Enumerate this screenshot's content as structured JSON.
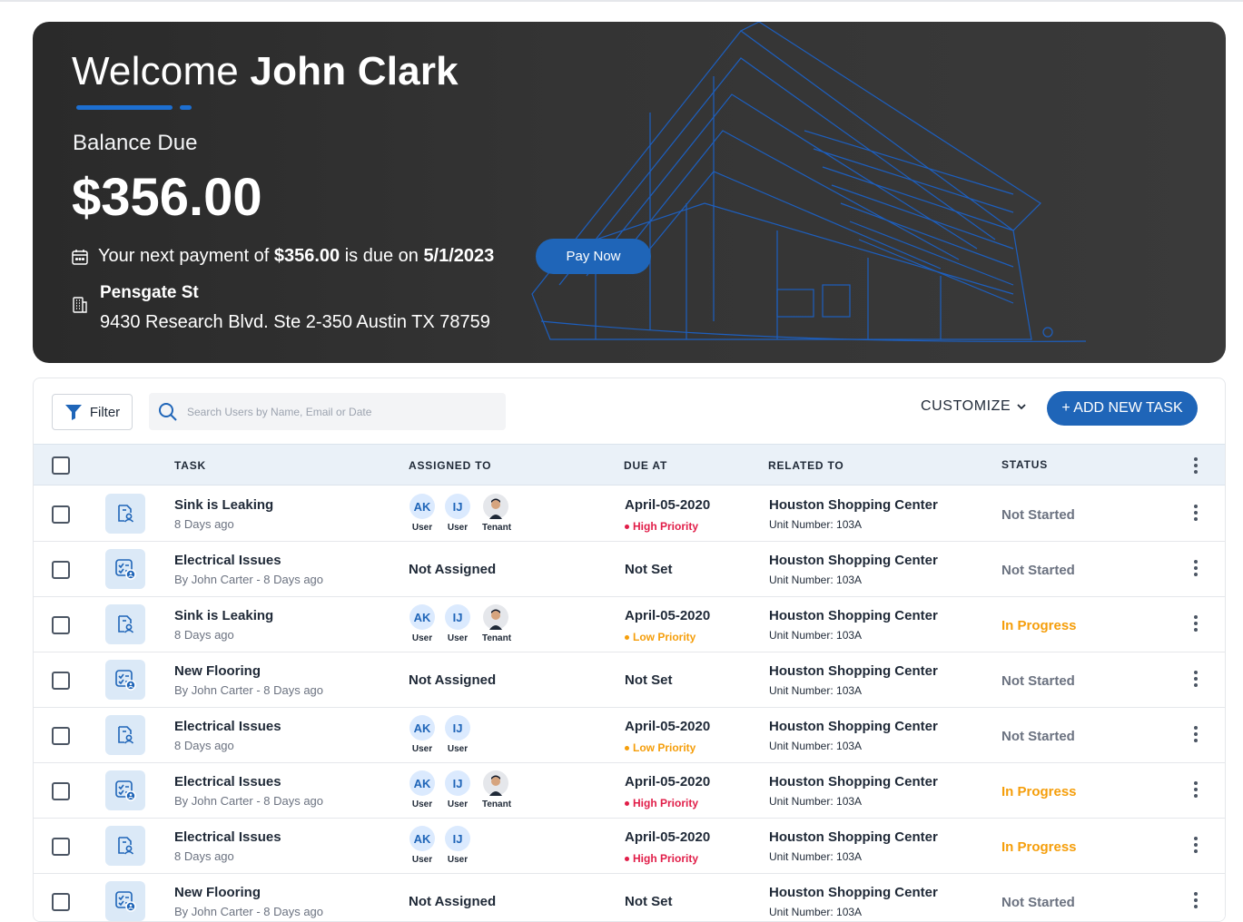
{
  "hero": {
    "welcome_prefix": "Welcome",
    "user_name": "John Clark",
    "balance_label": "Balance Due",
    "balance_amount": "$356.00",
    "next_payment_prefix": "Your next payment of",
    "next_payment_amount": "$356.00",
    "next_payment_middle": "is due on",
    "next_payment_date": "5/1/2023",
    "pay_button": "Pay Now",
    "property_name": "Pensgate St",
    "property_address": "9430 Research Blvd. Ste 2-350 Austin TX 78759"
  },
  "toolbar": {
    "filter_label": "Filter",
    "search_placeholder": "Search Users by Name, Email or Date",
    "customize_label": "CUSTOMIZE",
    "add_task_label": "+ ADD NEW TASK"
  },
  "table": {
    "headers": {
      "task": "TASK",
      "assigned_to": "ASSIGNED TO",
      "due_at": "DUE AT",
      "related_to": "RELATED TO",
      "status": "STATUS"
    },
    "rows": [
      {
        "task": "Sink is Leaking",
        "subtitle": "8 Days ago",
        "icon": "document-user-icon",
        "assignees": [
          {
            "initials": "AK",
            "role": "User"
          },
          {
            "initials": "IJ",
            "role": "User"
          },
          {
            "photo": true,
            "role": "Tenant"
          }
        ],
        "due": "April-05-2020",
        "priority": "High Priority",
        "related": "Houston Shopping Center",
        "unit": "Unit Number: 103A",
        "status": "Not Started"
      },
      {
        "task": "Electrical Issues",
        "subtitle": "By John Carter - 8 Days ago",
        "icon": "checklist-user-icon",
        "not_assigned": "Not Assigned",
        "due": "Not Set",
        "priority": "",
        "related": "Houston Shopping Center",
        "unit": "Unit Number: 103A",
        "status": "Not Started"
      },
      {
        "task": "Sink is Leaking",
        "subtitle": "8 Days ago",
        "icon": "document-user-icon",
        "assignees": [
          {
            "initials": "AK",
            "role": "User"
          },
          {
            "initials": "IJ",
            "role": "User"
          },
          {
            "photo": true,
            "role": "Tenant"
          }
        ],
        "due": "April-05-2020",
        "priority": "Low Priority",
        "related": "Houston Shopping Center",
        "unit": "Unit Number: 103A",
        "status": "In Progress"
      },
      {
        "task": "New Flooring",
        "subtitle": "By John Carter - 8 Days ago",
        "icon": "checklist-user-icon",
        "not_assigned": "Not Assigned",
        "due": "Not Set",
        "priority": "",
        "related": "Houston Shopping Center",
        "unit": "Unit Number: 103A",
        "status": "Not Started"
      },
      {
        "task": "Electrical Issues",
        "subtitle": "8 Days ago",
        "icon": "document-user-icon",
        "assignees": [
          {
            "initials": "AK",
            "role": "User"
          },
          {
            "initials": "IJ",
            "role": "User"
          }
        ],
        "due": "April-05-2020",
        "priority": "Low Priority",
        "related": "Houston Shopping Center",
        "unit": "Unit Number: 103A",
        "status": "Not Started"
      },
      {
        "task": "Electrical Issues",
        "subtitle": "By John Carter - 8 Days ago",
        "icon": "checklist-user-icon",
        "assignees": [
          {
            "initials": "AK",
            "role": "User"
          },
          {
            "initials": "IJ",
            "role": "User"
          },
          {
            "photo": true,
            "role": "Tenant"
          }
        ],
        "due": "April-05-2020",
        "priority": "High Priority",
        "related": "Houston Shopping Center",
        "unit": "Unit Number: 103A",
        "status": "In Progress"
      },
      {
        "task": "Electrical Issues",
        "subtitle": "8 Days ago",
        "icon": "document-user-icon",
        "assignees": [
          {
            "initials": "AK",
            "role": "User"
          },
          {
            "initials": "IJ",
            "role": "User"
          }
        ],
        "due": "April-05-2020",
        "priority": "High Priority",
        "related": "Houston Shopping Center",
        "unit": "Unit Number: 103A",
        "status": "In Progress"
      },
      {
        "task": "New Flooring",
        "subtitle": "By John Carter - 8 Days ago",
        "icon": "checklist-user-icon",
        "not_assigned": "Not Assigned",
        "due": "Not Set",
        "priority": "",
        "related": "Houston Shopping Center",
        "unit": "Unit Number: 103A",
        "status": "Not Started"
      }
    ]
  },
  "colors": {
    "accent": "#1f65b8",
    "high_priority": "#e11d48",
    "low_priority": "#f59e0b",
    "in_progress": "#f59e0b",
    "not_started": "#6b7280"
  }
}
